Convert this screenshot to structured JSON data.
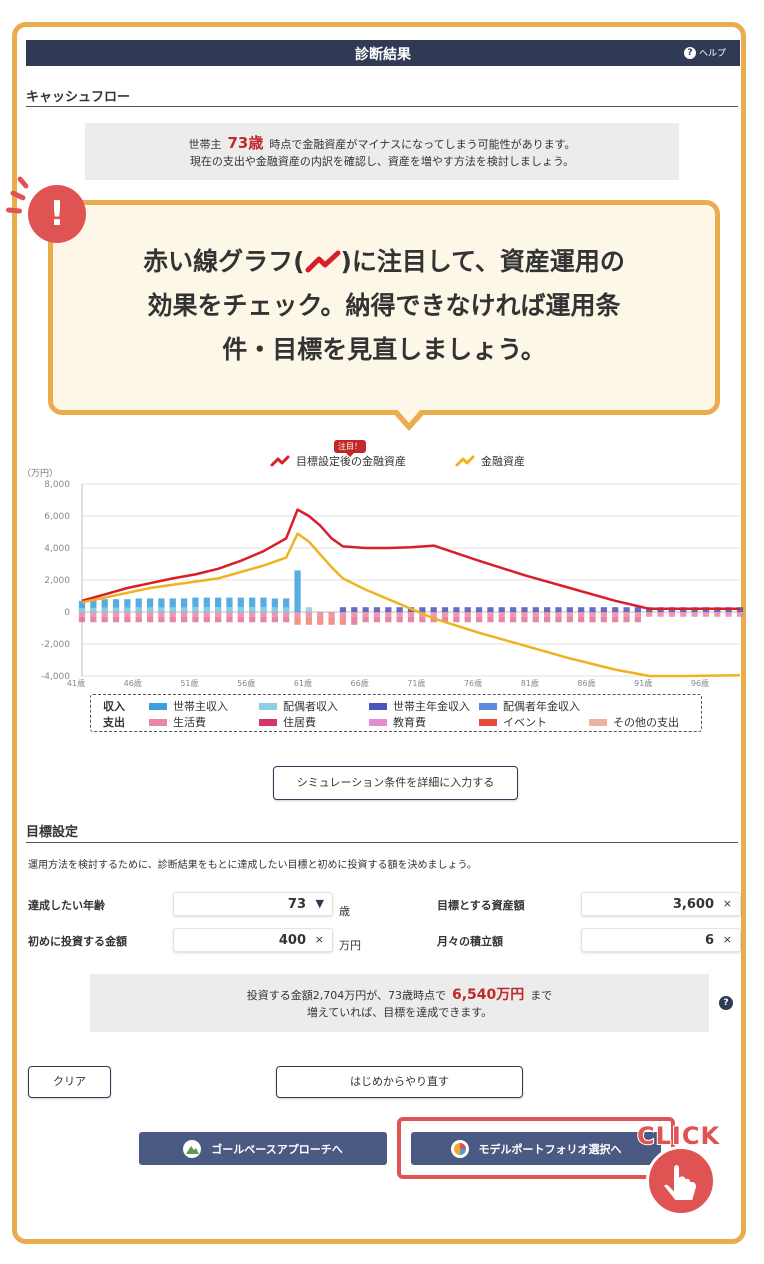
{
  "header": {
    "title": "診断結果",
    "help_label": "ヘルプ",
    "help_icon": "?"
  },
  "cashflow": {
    "section_title": "キャッシュフロー",
    "warning": {
      "prefix": "世帯主",
      "age": "73歳",
      "line1_rest": "時点で金融資産がマイナスになってしまう可能性があります。",
      "line2": "現在の支出や金融資産の内訳を確認し、資産を増やす方法を検討しましょう。"
    }
  },
  "callout": {
    "line1_pre": "赤い線グラフ(",
    "line1_post": ")に注目して、資産運用の",
    "line2": "効果をチェック。納得できなければ運用条",
    "line3": "件・目標を見直しましょう。",
    "alert_icon": "!"
  },
  "chart_legend_top": {
    "badge": "注目！",
    "series1": "目標設定後の金融資産",
    "series2": "金融資産"
  },
  "chart_legend_box": {
    "income_label": "収入",
    "expense_label": "支出",
    "income_items": [
      "世帯主収入",
      "配偶者収入",
      "世帯主年金収入",
      "配偶者年金収入"
    ],
    "expense_items": [
      "生活費",
      "住居費",
      "教育費",
      "イベント",
      "その他の支出"
    ]
  },
  "colors": {
    "target_line": "#d81e2a",
    "asset_line": "#f0b21e",
    "head_income": "#3a9fdc",
    "spouse_income": "#8ccfe6",
    "head_pension": "#4a54b9",
    "spouse_pension": "#5b8ad8",
    "living": "#e986a5",
    "housing": "#d6336c",
    "education": "#e48bd2",
    "event": "#e84b3c",
    "other": "#eab3a4"
  },
  "chart_data": {
    "type": "line",
    "ylabel": "（万円）",
    "ylim": [
      -4000,
      8000
    ],
    "yticks": [
      "8,000",
      "6,000",
      "4,000",
      "2,000",
      "0",
      "-2,000",
      "-4,000"
    ],
    "ytick_values": [
      8000,
      6000,
      4000,
      2000,
      0,
      -2000,
      -4000
    ],
    "xlim": [
      41,
      99
    ],
    "xticks": [
      "41歳",
      "46歳",
      "51歳",
      "56歳",
      "61歳",
      "66歳",
      "71歳",
      "76歳",
      "81歳",
      "86歳",
      "91歳",
      "96歳"
    ],
    "xtick_values": [
      41,
      46,
      51,
      56,
      61,
      66,
      71,
      76,
      81,
      86,
      91,
      96
    ],
    "grid": true,
    "series": [
      {
        "name": "目標設定後の金融資産",
        "color": "#d81e2a",
        "points": [
          [
            41,
            700
          ],
          [
            43,
            1100
          ],
          [
            45,
            1500
          ],
          [
            47,
            1800
          ],
          [
            49,
            2100
          ],
          [
            51,
            2350
          ],
          [
            53,
            2700
          ],
          [
            55,
            3200
          ],
          [
            57,
            3800
          ],
          [
            59,
            4600
          ],
          [
            60,
            6400
          ],
          [
            61,
            6000
          ],
          [
            62,
            5400
          ],
          [
            63,
            4600
          ],
          [
            64,
            4100
          ],
          [
            66,
            4000
          ],
          [
            68,
            4000
          ],
          [
            70,
            4050
          ],
          [
            72,
            4150
          ],
          [
            76,
            3200
          ],
          [
            80,
            2300
          ],
          [
            84,
            1500
          ],
          [
            88,
            700
          ],
          [
            91,
            200
          ],
          [
            94,
            200
          ],
          [
            99,
            200
          ]
        ]
      },
      {
        "name": "金融資産",
        "color": "#f0b21e",
        "points": [
          [
            41,
            600
          ],
          [
            43,
            900
          ],
          [
            45,
            1200
          ],
          [
            47,
            1500
          ],
          [
            49,
            1700
          ],
          [
            51,
            1900
          ],
          [
            53,
            2100
          ],
          [
            55,
            2500
          ],
          [
            57,
            2900
          ],
          [
            59,
            3400
          ],
          [
            60,
            4900
          ],
          [
            61,
            4400
          ],
          [
            62,
            3600
          ],
          [
            63,
            2800
          ],
          [
            64,
            2100
          ],
          [
            66,
            1400
          ],
          [
            68,
            800
          ],
          [
            70,
            200
          ],
          [
            72,
            -400
          ],
          [
            76,
            -1300
          ],
          [
            80,
            -2100
          ],
          [
            84,
            -2900
          ],
          [
            88,
            -3600
          ],
          [
            91,
            -4000
          ],
          [
            94,
            -4000
          ],
          [
            99,
            -3950
          ]
        ]
      }
    ],
    "bars": {
      "head_income": [
        [
          41,
          700
        ],
        [
          42,
          750
        ],
        [
          43,
          800
        ],
        [
          44,
          800
        ],
        [
          45,
          800
        ],
        [
          46,
          850
        ],
        [
          47,
          850
        ],
        [
          48,
          850
        ],
        [
          49,
          850
        ],
        [
          50,
          850
        ],
        [
          51,
          900
        ],
        [
          52,
          900
        ],
        [
          53,
          900
        ],
        [
          54,
          900
        ],
        [
          55,
          900
        ],
        [
          56,
          900
        ],
        [
          57,
          900
        ],
        [
          58,
          850
        ],
        [
          59,
          850
        ],
        [
          60,
          2600
        ],
        [
          61,
          300
        ]
      ],
      "head_pension": [
        [
          64,
          300
        ],
        [
          65,
          300
        ],
        [
          66,
          300
        ],
        [
          67,
          300
        ],
        [
          68,
          300
        ],
        [
          69,
          300
        ],
        [
          70,
          300
        ],
        [
          71,
          300
        ],
        [
          72,
          300
        ],
        [
          73,
          300
        ],
        [
          74,
          300
        ],
        [
          75,
          300
        ],
        [
          76,
          300
        ],
        [
          77,
          300
        ],
        [
          78,
          300
        ],
        [
          79,
          300
        ],
        [
          80,
          300
        ],
        [
          81,
          300
        ],
        [
          82,
          300
        ],
        [
          83,
          300
        ],
        [
          84,
          300
        ],
        [
          85,
          300
        ],
        [
          86,
          300
        ],
        [
          87,
          300
        ],
        [
          88,
          300
        ],
        [
          89,
          300
        ],
        [
          90,
          300
        ],
        [
          91,
          300
        ],
        [
          92,
          300
        ],
        [
          93,
          300
        ],
        [
          94,
          300
        ],
        [
          95,
          300
        ],
        [
          96,
          300
        ],
        [
          97,
          300
        ],
        [
          98,
          300
        ],
        [
          99,
          300
        ]
      ],
      "living_min": -300,
      "housing_min": -800,
      "expense_range": [
        41,
        99
      ]
    }
  },
  "simulation_button": "シミュレーション条件を詳細に入力する",
  "goal": {
    "section_title": "目標設定",
    "description": "運用方法を検討するために、診断結果をもとに達成したい目標と初めに投資する額を決めましょう。",
    "age_label": "達成したい年齢",
    "age_value": "73",
    "age_unit": "歳",
    "initial_label": "初めに投資する金額",
    "initial_value": "400",
    "initial_unit": "万円",
    "target_label": "目標とする資産額",
    "target_value": "3,600",
    "monthly_label": "月々の積立額",
    "monthly_value": "6",
    "clear_icon": "×",
    "dropdown_icon": "▼"
  },
  "result": {
    "line1_pre": "投資する金額2,704万円が、73歳時点で",
    "amount": "6,540万円",
    "line1_post": "まで",
    "line2": "増えていれば、目標を達成できます。",
    "help_icon": "?"
  },
  "buttons": {
    "clear": "クリア",
    "restart": "はじめからやり直す",
    "goal_based": "ゴールベースアプローチへ",
    "model_portfolio": "モデルポートフォリオ選択へ",
    "click_label": "CLICK"
  }
}
